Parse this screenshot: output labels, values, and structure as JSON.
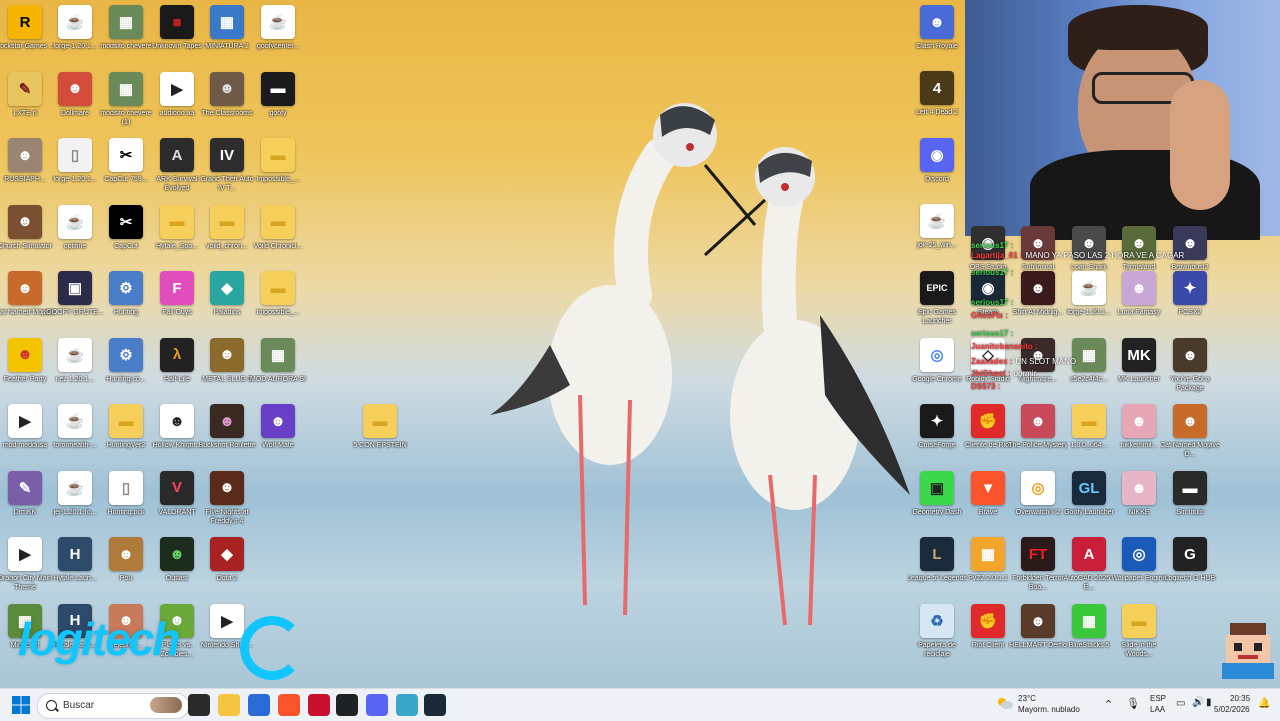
{
  "left_icons": [
    {
      "label": "Rockstar Games ...",
      "color": "#f5b400",
      "glyph": "R",
      "fg": "#000"
    },
    {
      "label": "forge-1.20.1...",
      "color": "#ffffff",
      "glyph": "☕",
      "fg": "#e76f00"
    },
    {
      "label": "modsito chevere",
      "color": "#6b8a5a",
      "glyph": "▦",
      "fg": "#fff"
    },
    {
      "label": "Unknown Tapes",
      "color": "#1a1a1a",
      "glyph": "■",
      "fg": "#b22"
    },
    {
      "label": "MINIATURA 2",
      "color": "#3a78c8",
      "glyph": "▦",
      "fg": "#fff"
    },
    {
      "label": "goofycenter...",
      "color": "#ffffff",
      "glyph": "☕",
      "fg": "#e76f00"
    },
    {
      "label": "LXTE.rl",
      "color": "#e7c45e",
      "glyph": "✎",
      "fg": "#7a1a1a"
    },
    {
      "label": "Dollmare",
      "color": "#d24b3b",
      "glyph": "☻",
      "fg": "#fff"
    },
    {
      "label": "modsito chevere (1)",
      "color": "#6b8a5a",
      "glyph": "▦",
      "fg": "#fff"
    },
    {
      "label": "audiooo aa",
      "color": "#ffffff",
      "glyph": "▶",
      "fg": "#222"
    },
    {
      "label": "The Classrooms",
      "color": "#6e5a47",
      "glyph": "☻",
      "fg": "#ddd"
    },
    {
      "label": "goofy",
      "color": "#1b1b1b",
      "glyph": "▬",
      "fg": "#fff"
    },
    {
      "label": "RUSSIAPH...",
      "color": "#9a8472",
      "glyph": "☻",
      "fg": "#fff"
    },
    {
      "label": "forge-1.20.1...",
      "color": "#f2f2f2",
      "glyph": "▯",
      "fg": "#888"
    },
    {
      "label": "CapCut 759...",
      "color": "#ffffff",
      "glyph": "✂",
      "fg": "#000"
    },
    {
      "label": "ARK Survival Evolved",
      "color": "#2b2b2b",
      "glyph": "A",
      "fg": "#ddd"
    },
    {
      "label": "Grand Theft Auto IV T...",
      "color": "#2d2d2d",
      "glyph": "IV",
      "fg": "#fff"
    },
    {
      "label": "Impossible_...",
      "color": "#f5cf5a",
      "glyph": "▬",
      "fg": "#d9a520"
    },
    {
      "label": "Church Simulator",
      "color": "#7a5030",
      "glyph": "☻",
      "fg": "#fff"
    },
    {
      "label": "optifine",
      "color": "#ffffff",
      "glyph": "☕",
      "fg": "#e76f00"
    },
    {
      "label": "CapCut",
      "color": "#000000",
      "glyph": "✂",
      "fg": "#fff"
    },
    {
      "label": "Hytale_Spa...",
      "color": "#f5cf5a",
      "glyph": "▬",
      "fg": "#d9a520"
    },
    {
      "label": "voild_chron...",
      "color": "#f5cf5a",
      "glyph": "▬",
      "fg": "#d9a520"
    },
    {
      "label": "Voild Chronicl...",
      "color": "#f5cf5a",
      "glyph": "▬",
      "fg": "#d9a520"
    },
    {
      "label": "Cat Named Mojave",
      "color": "#c86b2a",
      "glyph": "☻",
      "fg": "#fff"
    },
    {
      "label": "GOOFY GRUTE...",
      "color": "#2c2c4a",
      "glyph": "▣",
      "fg": "#fff"
    },
    {
      "label": "Hunting",
      "color": "#4a7dc8",
      "glyph": "⚙",
      "fg": "#fff"
    },
    {
      "label": "Fall Guys",
      "color": "#e14dbd",
      "glyph": "F",
      "fg": "#fff"
    },
    {
      "label": "Paladins",
      "color": "#2aa6a0",
      "glyph": "◆",
      "fg": "#fff"
    },
    {
      "label": "Impossible_...",
      "color": "#f5cf5a",
      "glyph": "▬",
      "fg": "#d9a520"
    },
    {
      "label": "Feather Party",
      "color": "#f5c400",
      "glyph": "☻",
      "fg": "#c33"
    },
    {
      "label": "i.ez 1.20.1...",
      "color": "#ffffff",
      "glyph": "☕",
      "fg": "#e76f00"
    },
    {
      "label": "Hunting.co...",
      "color": "#4a7dc8",
      "glyph": "⚙",
      "fg": "#fff"
    },
    {
      "label": "Half-Life",
      "color": "#222222",
      "glyph": "λ",
      "fg": "#f29b21"
    },
    {
      "label": "METAL SLUG 3",
      "color": "#8b6b2c",
      "glyph": "☻",
      "fg": "#fff"
    },
    {
      "label": "MOD AURORA SI",
      "color": "#6b8a5a",
      "glyph": "▦",
      "fg": "#fff"
    },
    {
      "label": "mod meddusa",
      "color": "#ffffff",
      "glyph": "▶",
      "fg": "#222"
    },
    {
      "label": "toronhealth-...",
      "color": "#ffffff",
      "glyph": "☕",
      "fg": "#e76f00"
    },
    {
      "label": "HuntingVer2",
      "color": "#f5cf5a",
      "glyph": "▬",
      "fg": "#d9a520"
    },
    {
      "label": "Hollow Knight...",
      "color": "#ffffff",
      "glyph": "☻",
      "fg": "#222"
    },
    {
      "label": "Buckshot Roulette",
      "color": "#3a2a22",
      "glyph": "☻",
      "fg": "#d9c"
    },
    {
      "label": "Wolf Mate",
      "color": "#6a3fc8",
      "glyph": "☻",
      "fg": "#fff"
    },
    {
      "label": "5 CON EPSTEIN",
      "color": "#f5cf5a",
      "glyph": "▬",
      "fg": "#d9a520"
    },
    {
      "label": "DrmKK",
      "color": "#7a5fa8",
      "glyph": "✎",
      "fg": "#fff"
    },
    {
      "label": "jei-1.20.1-fo...",
      "color": "#ffffff",
      "glyph": "☕",
      "fg": "#e76f00"
    },
    {
      "label": "Hunting.pck",
      "color": "#ffffff",
      "glyph": "▯",
      "fg": "#888"
    },
    {
      "label": "VALORANT",
      "color": "#2a2a2a",
      "glyph": "V",
      "fg": "#ff4655"
    },
    {
      "label": "Five Nights at Freddy's 4",
      "color": "#5a2a1a",
      "glyph": "☻",
      "fg": "#fff"
    },
    {
      "label": "Dragon City Main Theme",
      "color": "#ffffff",
      "glyph": "▶",
      "fg": "#222"
    },
    {
      "label": "Hytale Laun...",
      "color": "#2e4a6a",
      "glyph": "H",
      "fg": "#fff"
    },
    {
      "label": "Pou",
      "color": "#b07a3a",
      "glyph": "☻",
      "fg": "#fff"
    },
    {
      "label": "Outlast",
      "color": "#1d2d1d",
      "glyph": "☻",
      "fg": "#6c6"
    },
    {
      "label": "Dota 2",
      "color": "#a92222",
      "glyph": "◆",
      "fg": "#fff"
    },
    {
      "label": "Minecraft",
      "color": "#5a8a3a",
      "glyph": "▦",
      "fg": "#fff"
    },
    {
      "label": "Hytale Laun...",
      "color": "#2e4a6a",
      "glyph": "H",
      "fg": "#fff"
    },
    {
      "label": "celebrity...",
      "color": "#c87a5a",
      "glyph": "☻",
      "fg": "#fff"
    },
    {
      "label": "Plants vs. Zombies...",
      "color": "#6aa83a",
      "glyph": "☻",
      "fg": "#fff"
    },
    {
      "label": "Nintendo Shop...",
      "color": "#ffffff",
      "glyph": "▶",
      "fg": "#222"
    }
  ],
  "right_icons": [
    {
      "label": "Clash Royale",
      "color": "#4a6ad8",
      "glyph": "☻",
      "fg": "#fff"
    },
    {
      "label": "Left 4 Dead 2",
      "color": "#4a3a1a",
      "glyph": "4",
      "fg": "#fff"
    },
    {
      "label": "Discord",
      "color": "#5865f2",
      "glyph": "◉",
      "fg": "#fff"
    },
    {
      "label": "jdk-25_win...",
      "color": "#ffffff",
      "glyph": "☕",
      "fg": "#e76f00"
    },
    {
      "label": "Epic Games Launcher",
      "color": "#1a1a1a",
      "glyph": "EPIC",
      "fg": "#fff"
    },
    {
      "label": "Google Chrome",
      "color": "#ffffff",
      "glyph": "◎",
      "fg": "#4285f4"
    },
    {
      "label": "CurseForge",
      "color": "#1a1a1a",
      "glyph": "✦",
      "fg": "#fff"
    },
    {
      "label": "Cliente de Riot",
      "color": "#e02a2a",
      "glyph": "✊",
      "fg": "#fff"
    },
    {
      "label": "The Police Mystery",
      "color": "#c84a5a",
      "glyph": "☻",
      "fg": "#fff"
    },
    {
      "label": "1.8.0_u64...",
      "color": "#f5cf5a",
      "glyph": "▬",
      "fg": "#d9a520"
    },
    {
      "label": "nikkeminil...",
      "color": "#e6a6b6",
      "glyph": "☻",
      "fg": "#fff"
    },
    {
      "label": "Cat Named Mojave D...",
      "color": "#c86b2a",
      "glyph": "☻",
      "fg": "#fff"
    },
    {
      "label": "Geometry Dash",
      "color": "#3ad84a",
      "glyph": "▣",
      "fg": "#222"
    },
    {
      "label": "Brave",
      "color": "#fb542b",
      "glyph": "▼",
      "fg": "#fff"
    },
    {
      "label": "Overwatch® 2",
      "color": "#ffffff",
      "glyph": "◎",
      "fg": "#f99e1a"
    },
    {
      "label": "Goofy Launcher",
      "color": "#1a2a3a",
      "glyph": "GL",
      "fg": "#6cf"
    },
    {
      "label": "NIKKE",
      "color": "#e6b6c6",
      "glyph": "☻",
      "fg": "#fff"
    },
    {
      "label": "Sin título",
      "color": "#2a2a2a",
      "glyph": "▬",
      "fg": "#fff"
    },
    {
      "label": "League of Legends",
      "color": "#1a2a3a",
      "glyph": "L",
      "fg": "#c8aa6e"
    },
    {
      "label": "PvZ2 2.0.1.1",
      "color": "#f2a52a",
      "glyph": "▦",
      "fg": "#fff"
    },
    {
      "label": "Forbidden Terror Boa...",
      "color": "#2a1a1a",
      "glyph": "FT",
      "fg": "#e22"
    },
    {
      "label": "AutoCAD 2025 - E...",
      "color": "#c81e3a",
      "glyph": "A",
      "fg": "#fff"
    },
    {
      "label": "Wallpaper Engine",
      "color": "#1a5ab8",
      "glyph": "◎",
      "fg": "#fff"
    },
    {
      "label": "Logitech G HUB",
      "color": "#222222",
      "glyph": "G",
      "fg": "#fff"
    },
    {
      "label": "Papelera de reciclaje",
      "color": "#d6e6f2",
      "glyph": "♻",
      "fg": "#2a6ab8"
    },
    {
      "label": "Riot Client",
      "color": "#e02a2a",
      "glyph": "✊",
      "fg": "#fff"
    },
    {
      "label": "HELLMART Demo",
      "color": "#5a3a2a",
      "glyph": "☻",
      "fg": "#fff"
    },
    {
      "label": "BlueStacks 5",
      "color": "#3ac83a",
      "glyph": "▦",
      "fg": "#fff"
    },
    {
      "label": "Slide in the Woods...",
      "color": "#f5cf5a",
      "glyph": "▬",
      "fg": "#d9a520"
    }
  ],
  "overlay_icons": [
    {
      "label": "OBS Studio",
      "color": "#302e31",
      "glyph": "◉",
      "fg": "#fff"
    },
    {
      "label": "Subliminal",
      "color": "#6a3a3a",
      "glyph": "☻",
      "fg": "#fff"
    },
    {
      "label": "Loan Shark",
      "color": "#4a4a4a",
      "glyph": "☻",
      "fg": "#fff"
    },
    {
      "label": "Tarmaland",
      "color": "#5a6a3a",
      "glyph": "☻",
      "fg": "#fff"
    },
    {
      "label": "Brownbust2 Launcher",
      "color": "#3a3a5a",
      "glyph": "☻",
      "fg": "#fff"
    },
    {
      "label": "Steam",
      "color": "#1b2838",
      "glyph": "◉",
      "fg": "#fff"
    },
    {
      "label": "Shift At Midnig...",
      "color": "#3a1a1a",
      "glyph": "☻",
      "fg": "#fff"
    },
    {
      "label": "forge-1.20.1...",
      "color": "#ffffff",
      "glyph": "☕",
      "fg": "#e76f00"
    },
    {
      "label": "Luna Fantasy",
      "color": "#c8a6d6",
      "glyph": "☻",
      "fg": "#fff"
    },
    {
      "label": "PCSX2",
      "color": "#3a4aa8",
      "glyph": "✦",
      "fg": "#fff"
    },
    {
      "label": "Roblox Studio",
      "color": "#ffffff",
      "glyph": "◇",
      "fg": "#333"
    },
    {
      "label": "Nightmare...",
      "color": "#3a2a2a",
      "glyph": "☻",
      "fg": "#fff"
    },
    {
      "label": "c5e2c4f4c...",
      "color": "#6b8a5a",
      "glyph": "▦",
      "fg": "#fff"
    },
    {
      "label": "MK Launcher",
      "color": "#222222",
      "glyph": "MK",
      "fg": "#fff"
    },
    {
      "label": "You've Got a Package",
      "color": "#4a3a2a",
      "glyph": "☻",
      "fg": "#fff"
    }
  ],
  "chat": [
    {
      "user": "serious17 :",
      "msg": "",
      "green": true
    },
    {
      "user": "Lagartija_01 :",
      "msg": "MANO YA PASO LAS 2 HORA VE A CAGAR",
      "green": false
    },
    {
      "user": "serious17 :",
      "msg": "",
      "green": true
    },
    {
      "user": "serious17 :",
      "msg": "",
      "green": true
    },
    {
      "user": "GhosFix :",
      "msg": "",
      "green": false
    },
    {
      "user": "serious17 :",
      "msg": "",
      "green": true
    },
    {
      "user": "Juanitobananito :",
      "msg": "",
      "green": false
    },
    {
      "user": "Zaaxadex :",
      "msg": "UN SLOT MANO",
      "green": false
    },
    {
      "user": "JhiGhost :",
      "msg": "dormir",
      "green": false
    },
    {
      "user": "DS573 :",
      "msg": "",
      "green": false
    }
  ],
  "watermark": {
    "text": "logitech"
  },
  "taskbar": {
    "search_placeholder": "Buscar",
    "weather_temp": "23°C",
    "weather_desc": "Mayorm. nublado",
    "lang_top": "ESP",
    "lang_bottom": "LAA",
    "time": "20:35",
    "date": "5/02/2026",
    "apps": [
      {
        "name": "task-view-icon",
        "color": "#2a2a2a"
      },
      {
        "name": "file-explorer-icon",
        "color": "#f5c542"
      },
      {
        "name": "microsoft-store-icon",
        "color": "#2a6ad8"
      },
      {
        "name": "brave-icon",
        "color": "#fb542b"
      },
      {
        "name": "netflix-app-icon",
        "color": "#c8102e"
      },
      {
        "name": "chatgpt-icon",
        "color": "#202123"
      },
      {
        "name": "discord-icon",
        "color": "#5865f2"
      },
      {
        "name": "notepad-icon",
        "color": "#3aa6c8"
      },
      {
        "name": "steam-icon",
        "color": "#1b2838"
      }
    ]
  },
  "colors": {
    "accent": "#0078d4",
    "watermark": "#11c6ff"
  }
}
